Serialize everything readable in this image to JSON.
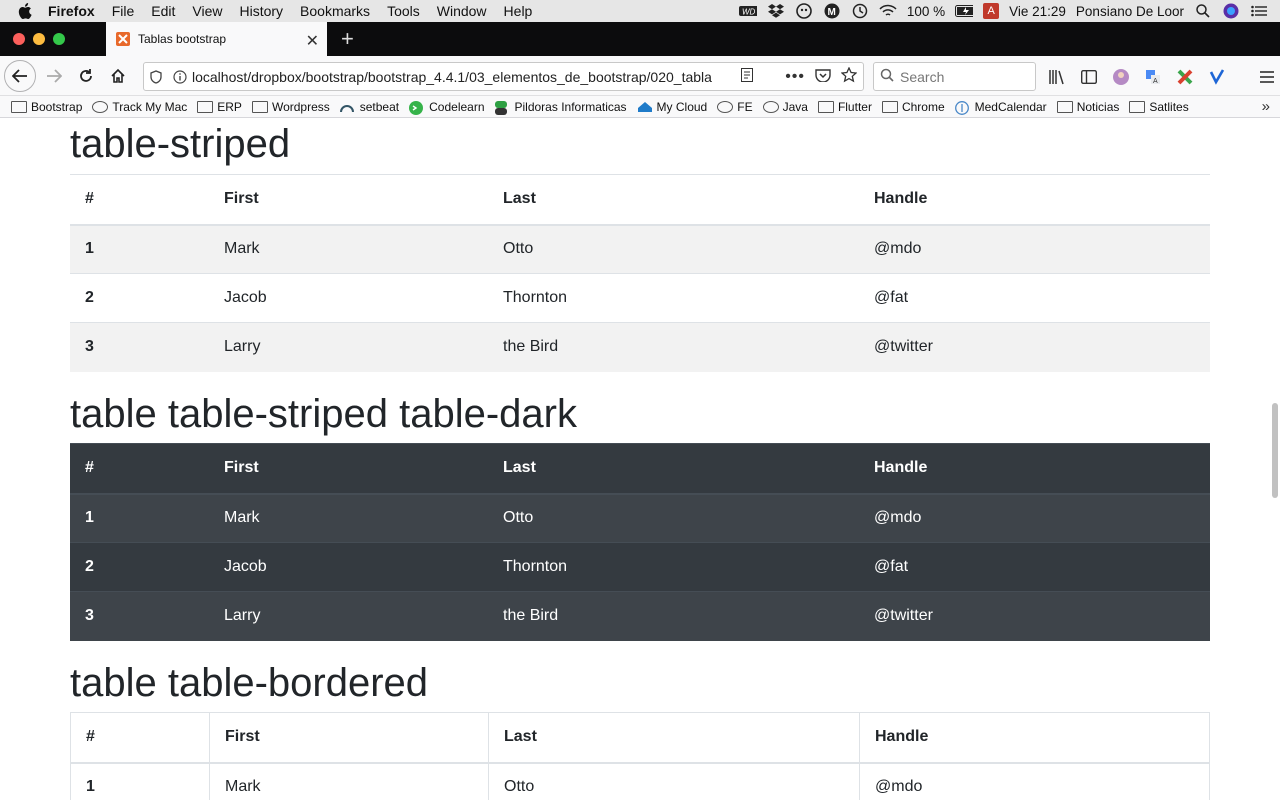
{
  "menubar": {
    "app": "Firefox",
    "items": [
      "File",
      "Edit",
      "View",
      "History",
      "Bookmarks",
      "Tools",
      "Window",
      "Help"
    ],
    "battery": "100 %",
    "clock": "Vie 21:29",
    "user": "Ponsiano De Loor",
    "badge": "A"
  },
  "tab": {
    "title": "Tablas bootstrap"
  },
  "url": "localhost/dropbox/bootstrap/bootstrap_4.4.1/03_elementos_de_bootstrap/020_tabla",
  "search": {
    "placeholder": "Search"
  },
  "bookmarks": [
    "Bootstrap",
    "Track My Mac",
    "ERP",
    "Wordpress",
    "setbeat",
    "Codelearn",
    "Pildoras Informaticas",
    "My Cloud",
    "FE",
    "Java",
    "Flutter",
    "Chrome",
    "MedCalendar",
    "Noticias",
    "Satlites"
  ],
  "sections": [
    {
      "title": "table-striped"
    },
    {
      "title": "table table-striped table-dark"
    },
    {
      "title": "table table-bordered"
    }
  ],
  "table": {
    "headers": [
      "#",
      "First",
      "Last",
      "Handle"
    ],
    "rows": [
      [
        "1",
        "Mark",
        "Otto",
        "@mdo"
      ],
      [
        "2",
        "Jacob",
        "Thornton",
        "@fat"
      ],
      [
        "3",
        "Larry",
        "the Bird",
        "@twitter"
      ]
    ]
  },
  "colors": {
    "dark_table": "#343a40",
    "stripe": "#f2f2f2",
    "text": "#212529"
  }
}
